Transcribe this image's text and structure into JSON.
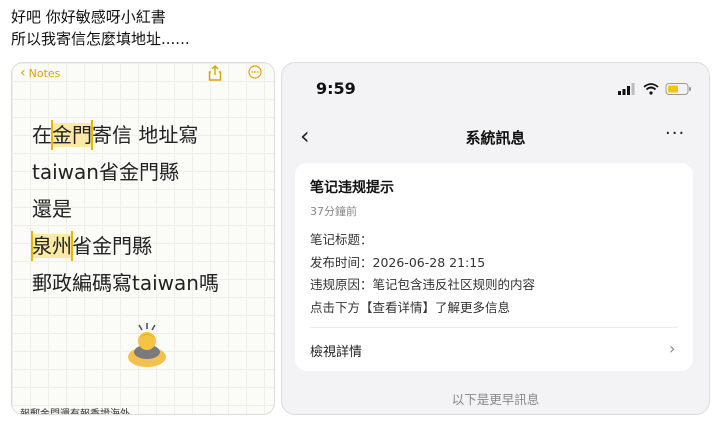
{
  "caption": {
    "line1": "好吧 你好敏感呀小紅書",
    "line2": "所以我寄信怎麼填地址......"
  },
  "notes": {
    "back_label": "Notes",
    "icons": [
      "chevron-left-icon",
      "share-icon",
      "more-icon"
    ],
    "lines": [
      {
        "pre": "在",
        "hl": "金門",
        "post": "寄信 地址寫"
      },
      {
        "pre": "taiwan省金門縣",
        "hl": "",
        "post": ""
      },
      {
        "pre": "還是",
        "hl": "",
        "post": ""
      },
      {
        "pre": "",
        "hl": "泉州",
        "post": "省金門縣"
      },
      {
        "pre": "郵政編碼寫taiwan嗎",
        "hl": "",
        "post": ""
      }
    ],
    "emoji": "person-bowing-icon",
    "cut_text": "報郵金門還有報香證海外"
  },
  "phone": {
    "time": "9:59",
    "status_icons": [
      "signal-icon",
      "wifi-icon",
      "battery-icon"
    ],
    "nav": {
      "back": "‹",
      "title": "系統訊息",
      "more": "···"
    },
    "message": {
      "title": "笔记违规提示",
      "time_ago": "37分鐘前",
      "lines": [
        "笔记标题：",
        "发布时间：2026-06-28 21:15",
        "违规原因：笔记包含违反社区规则的内容",
        "点击下方【查看详情】了解更多信息"
      ],
      "link_label": "檢視詳情",
      "chevron": "›"
    },
    "older_label": "以下是更早訊息"
  },
  "colors": {
    "notes_accent": "#d9a400",
    "highlight": "#fbe9a6",
    "phone_bg": "#f3f3f5",
    "battery": "#f1c40f"
  }
}
